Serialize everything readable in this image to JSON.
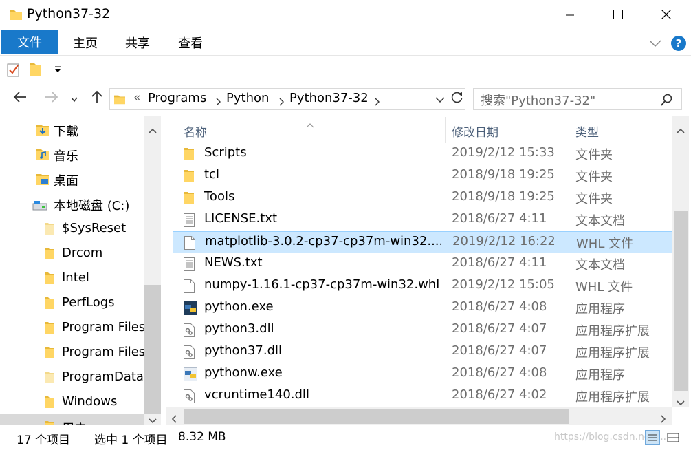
{
  "window": {
    "title": "Python37-32",
    "controls": [
      "minimize-icon",
      "maximize-icon",
      "close-icon"
    ]
  },
  "ribbon": {
    "tabs": [
      {
        "label": "文件"
      },
      {
        "label": "主页"
      },
      {
        "label": "共享"
      },
      {
        "label": "查看"
      }
    ],
    "accent": "#1979ca"
  },
  "address": {
    "overflow": "«",
    "crumbs": [
      "Programs",
      "Python",
      "Python37-32"
    ]
  },
  "search": {
    "placeholder": "搜索\"Python37-32\""
  },
  "sidebar": {
    "items": [
      {
        "label": "下载",
        "icon": "download-folder-icon"
      },
      {
        "label": "音乐",
        "icon": "music-folder-icon"
      },
      {
        "label": "桌面",
        "icon": "desktop-folder-icon"
      },
      {
        "label": "本地磁盘 (C:)",
        "icon": "drive-icon"
      },
      {
        "label": "$SysReset",
        "icon": "folder-icon"
      },
      {
        "label": "Drcom",
        "icon": "folder-icon"
      },
      {
        "label": "Intel",
        "icon": "folder-icon"
      },
      {
        "label": "PerfLogs",
        "icon": "folder-icon"
      },
      {
        "label": "Program Files",
        "icon": "folder-icon"
      },
      {
        "label": "Program Files",
        "icon": "folder-icon"
      },
      {
        "label": "ProgramData",
        "icon": "folder-icon"
      },
      {
        "label": "Windows",
        "icon": "folder-icon"
      },
      {
        "label": "用户",
        "icon": "folder-icon"
      }
    ]
  },
  "files": {
    "columns": {
      "name": "名称",
      "date": "修改日期",
      "type": "类型"
    },
    "rows": [
      {
        "name": "Scripts",
        "date": "2019/2/12 15:33",
        "type": "文件夹",
        "icon": "folder-icon"
      },
      {
        "name": "tcl",
        "date": "2018/9/18 19:25",
        "type": "文件夹",
        "icon": "folder-icon"
      },
      {
        "name": "Tools",
        "date": "2018/9/18 19:25",
        "type": "文件夹",
        "icon": "folder-icon"
      },
      {
        "name": "LICENSE.txt",
        "date": "2018/6/27 4:11",
        "type": "文本文档",
        "icon": "text-file-icon"
      },
      {
        "name": "matplotlib-3.0.2-cp37-cp37m-win32....",
        "date": "2019/2/12 16:22",
        "type": "WHL 文件",
        "icon": "blank-file-icon",
        "selected": true
      },
      {
        "name": "NEWS.txt",
        "date": "2018/6/27 4:11",
        "type": "文本文档",
        "icon": "text-file-icon"
      },
      {
        "name": "numpy-1.16.1-cp37-cp37m-win32.whl",
        "date": "2019/2/12 15:05",
        "type": "WHL 文件",
        "icon": "blank-file-icon"
      },
      {
        "name": "python.exe",
        "date": "2018/6/27 4:08",
        "type": "应用程序",
        "icon": "python-exe-icon"
      },
      {
        "name": "python3.dll",
        "date": "2018/6/27 4:07",
        "type": "应用程序扩展",
        "icon": "dll-icon"
      },
      {
        "name": "python37.dll",
        "date": "2018/6/27 4:07",
        "type": "应用程序扩展",
        "icon": "dll-icon"
      },
      {
        "name": "pythonw.exe",
        "date": "2018/6/27 4:08",
        "type": "应用程序",
        "icon": "pythonw-exe-icon"
      },
      {
        "name": "vcruntime140.dll",
        "date": "2018/6/27 4:02",
        "type": "应用程序扩展",
        "icon": "dll-icon"
      }
    ]
  },
  "status": {
    "count": "17 个项目",
    "selected": "选中 1 个项目",
    "size": "8.32 MB",
    "watermark": "https://blog.csdn.net/..."
  }
}
